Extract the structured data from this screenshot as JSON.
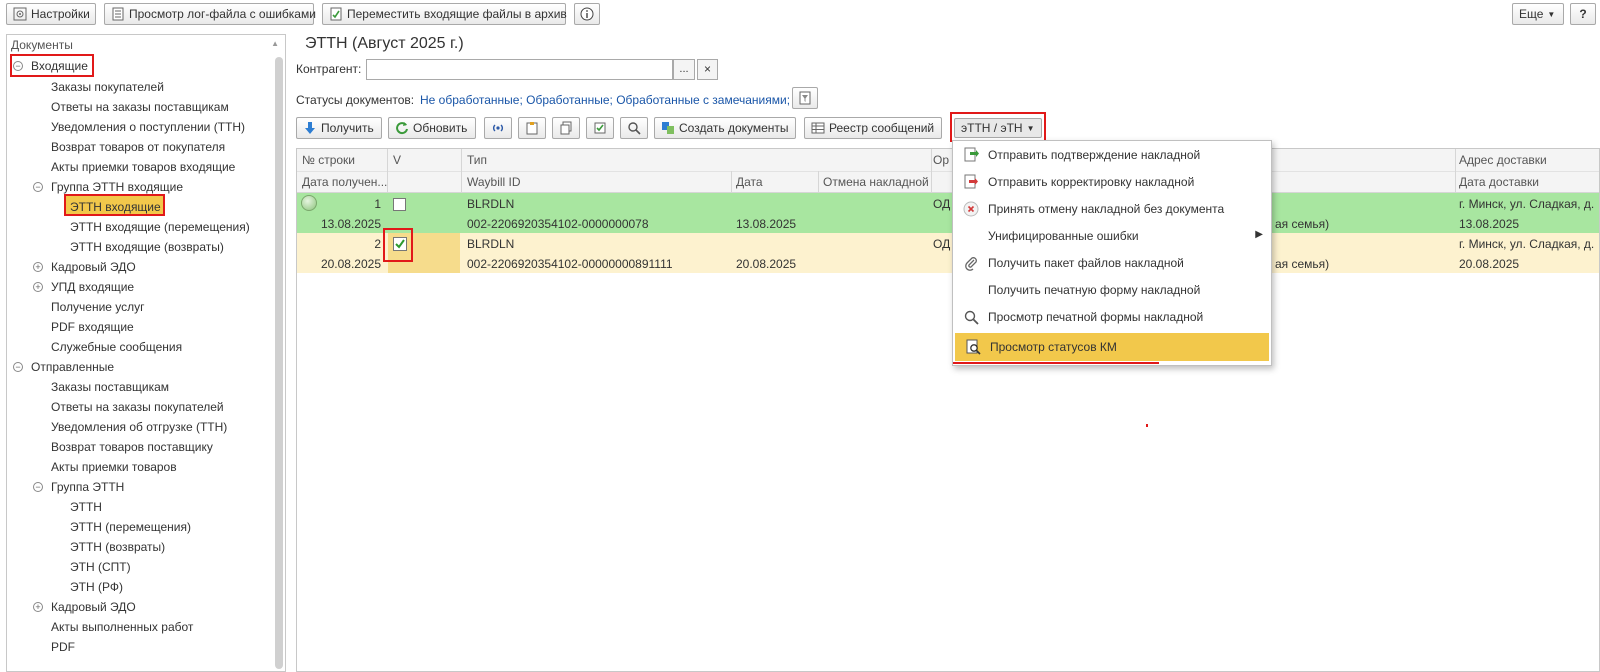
{
  "toolbar": {
    "settings": "Настройки",
    "view_log": "Просмотр лог-файла с ошибками",
    "move_archive": "Переместить входящие файлы в архив",
    "more": "Еще",
    "help": "?"
  },
  "sidebar": {
    "header": "Документы",
    "incoming": {
      "label": "Входящие",
      "items": [
        "Заказы покупателей",
        "Ответы на заказы поставщикам",
        "Уведомления о поступлении (ТТН)",
        "Возврат товаров от покупателя",
        "Акты приемки товаров входящие"
      ],
      "group_etth": {
        "label": "Группа ЭТТН входящие",
        "items": [
          "ЭТТН входящие",
          "ЭТТН входящие (перемещения)",
          "ЭТТН входящие (возвраты)"
        ]
      },
      "hr_edo": "Кадровый ЭДО",
      "upd": "УПД входящие",
      "services": "Получение услуг",
      "pdf": "PDF входящие",
      "service_msgs": "Служебные сообщения"
    },
    "sent": {
      "label": "Отправленные",
      "items": [
        "Заказы поставщикам",
        "Ответы на заказы покупателей",
        "Уведомления об отгрузке (ТТН)",
        "Возврат товаров поставщику",
        "Акты приемки товаров"
      ],
      "group_etth": {
        "label": "Группа ЭТТН",
        "items": [
          "ЭТТН",
          "ЭТТН (перемещения)",
          "ЭТТН (возвраты)",
          "ЭТН (СПТ)",
          "ЭТН (РФ)"
        ]
      },
      "hr_edo": "Кадровый ЭДО",
      "acts": "Акты выполненных работ",
      "pdf": "PDF"
    }
  },
  "main": {
    "title": "ЭТТН (Август 2025 г.)",
    "contractor_label": "Контрагент:",
    "contractor_value": "",
    "contractor_pick": "...",
    "contractor_clear": "×",
    "statuses_label": "Статусы документов:",
    "statuses_value": "Не обработанные; Обработанные; Обработанные с замечаниями;",
    "actions": {
      "receive": "Получить",
      "refresh": "Обновить",
      "create_docs": "Создать документы",
      "registry": "Реестр сообщений",
      "etth_menu": "эТТН / эТН"
    }
  },
  "grid": {
    "header_row1": [
      "№ строки",
      "V",
      "Тип",
      "Ор",
      "Адрес доставки"
    ],
    "header_row2": [
      "Дата получен...",
      "Waybill ID",
      "Дата",
      "Отмена накладной",
      "Дата доставки"
    ],
    "rows": [
      {
        "num": "1",
        "received": "13.08.2025",
        "checked": false,
        "type": "BLRDLN",
        "waybill": "002-2206920354102-0000000078",
        "date": "13.08.2025",
        "org": "ОД",
        "partial": "ая семья)",
        "address": "г. Минск, ул. Сладкая, д.",
        "delivery_date": "13.08.2025"
      },
      {
        "num": "2",
        "received": "20.08.2025",
        "checked": true,
        "type": "BLRDLN",
        "waybill": "002-2206920354102-00000000891111",
        "date": "20.08.2025",
        "org": "ОД",
        "partial": "ая семья)",
        "address": "г. Минск, ул. Сладкая, д.",
        "delivery_date": "20.08.2025"
      }
    ]
  },
  "menu": {
    "items": [
      "Отправить подтверждение накладной",
      "Отправить корректировку накладной",
      "Принять отмену накладной без документа",
      "Унифицированные ошибки",
      "Получить пакет файлов накладной",
      "Получить печатную форму накладной",
      "Просмотр печатной формы накладной",
      "Просмотр статусов КМ"
    ]
  },
  "colors": {
    "row_green": "#a8e6a0",
    "row_yellow": "#fdf2cf",
    "menu_highlight": "#f2c84b",
    "highlight_red": "#e11919",
    "link_blue": "#1a56a8"
  }
}
